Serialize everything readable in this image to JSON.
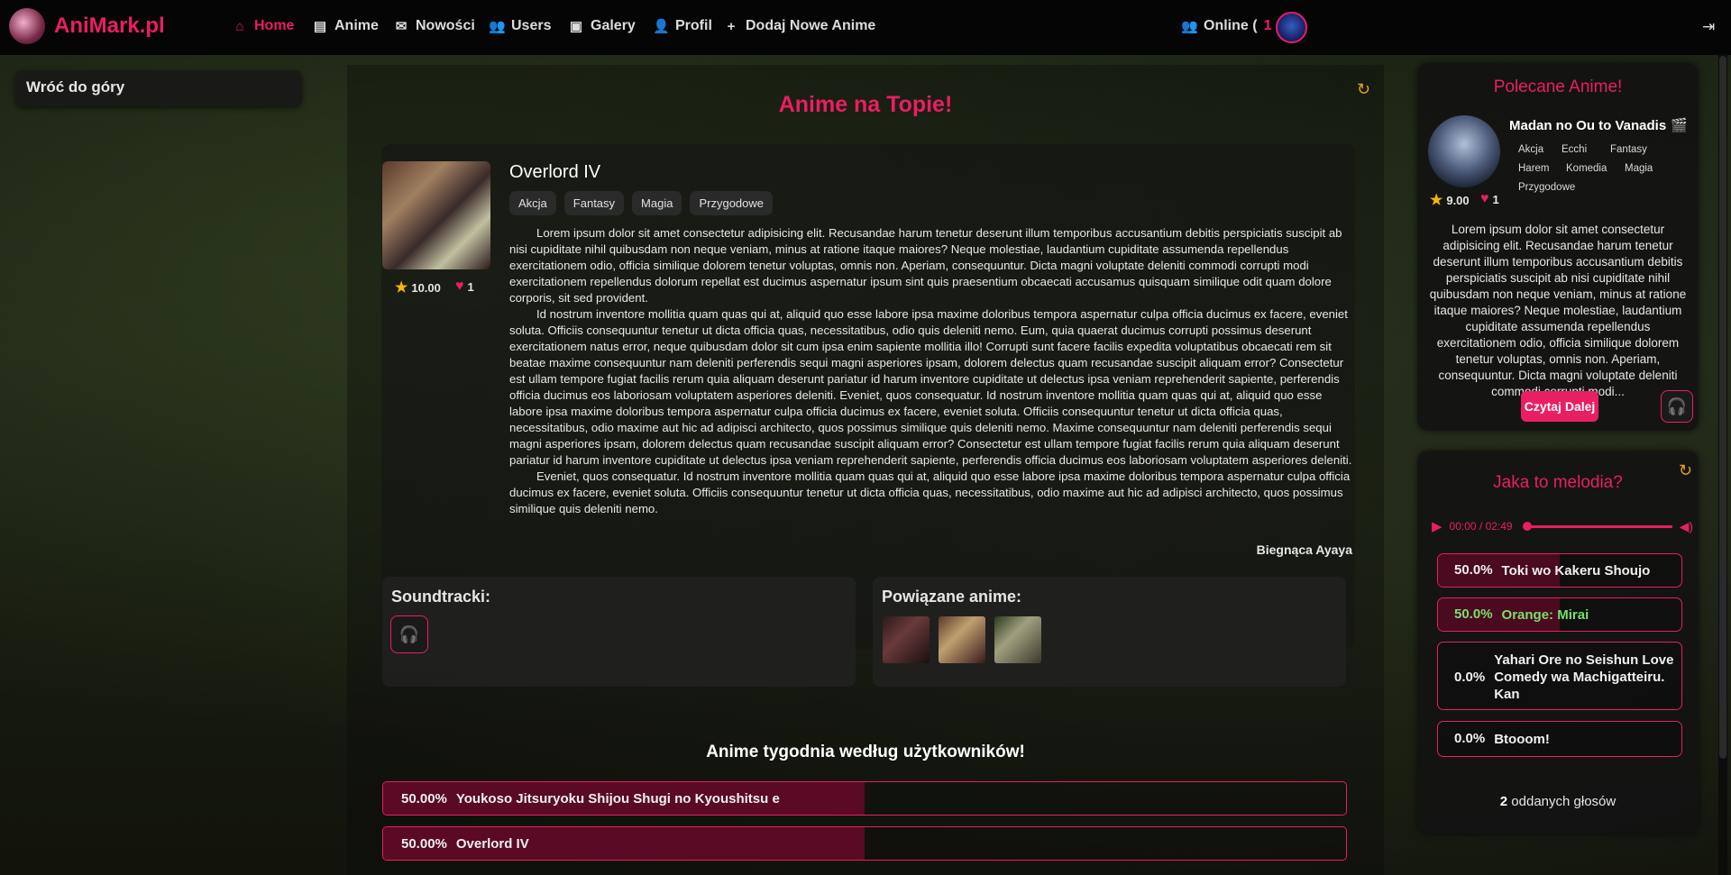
{
  "brand": {
    "name": "AniMark",
    "tld": ".pl"
  },
  "nav": {
    "items": [
      {
        "label": "Home",
        "icon": "home-icon",
        "active": true
      },
      {
        "label": "Anime",
        "icon": "clapperboard-icon"
      },
      {
        "label": "Nowości",
        "icon": "envelope-icon"
      },
      {
        "label": "Users",
        "icon": "users-icon"
      },
      {
        "label": "Galery",
        "icon": "images-icon"
      },
      {
        "label": "Profil",
        "icon": "user-icon"
      },
      {
        "label": "Dodaj Nowe Anime",
        "icon": "plus-icon"
      }
    ],
    "online_label": "Online (",
    "online_count": "1",
    "online_close": ")"
  },
  "sidebar": {
    "back_to_top": "Wróć do góry"
  },
  "top_anime": {
    "section_title": "Anime na Topie!",
    "title": "Overlord IV",
    "tags": [
      "Akcja",
      "Fantasy",
      "Magia",
      "Przygodowe"
    ],
    "rating": "10.00",
    "likes": "1",
    "description": [
      "Lorem ipsum dolor sit amet consectetur adipisicing elit. Recusandae harum tenetur deserunt illum temporibus accusantium debitis perspiciatis suscipit ab nisi cupiditate nihil quibusdam non neque veniam, minus at ratione itaque maiores? Neque molestiae, laudantium cupiditate assumenda repellendus exercitationem odio, officia similique dolorem tenetur voluptas, omnis non. Aperiam, consequuntur. Dicta magni voluptate deleniti commodi corrupti modi exercitationem repellendus dolorum repellat est ducimus aspernatur ipsum sint quis praesentium obcaecati accusamus quisquam similique odit quam dolore corporis, sit sed provident.",
      "Id nostrum inventore mollitia quam quas qui at, aliquid quo esse labore ipsa maxime doloribus tempora aspernatur culpa officia ducimus ex facere, eveniet soluta. Officiis consequuntur tenetur ut dicta officia quas, necessitatibus, odio quis deleniti nemo. Eum, quia quaerat ducimus corrupti possimus deserunt exercitationem natus error, neque quibusdam dolor sit cum ipsa enim sapiente mollitia illo! Corrupti sunt facere facilis expedita voluptatibus obcaecati rem sit beatae maxime consequuntur nam deleniti perferendis sequi magni asperiores ipsam, dolorem delectus quam recusandae suscipit aliquam error? Consectetur est ullam tempore fugiat facilis rerum quia aliquam deserunt pariatur id harum inventore cupiditate ut delectus ipsa veniam reprehenderit sapiente, perferendis officia ducimus eos laboriosam voluptatem asperiores deleniti. Eveniet, quos consequatur. Id nostrum inventore mollitia quam quas qui at, aliquid quo esse labore ipsa maxime doloribus tempora aspernatur culpa officia ducimus ex facere, eveniet soluta. Officiis consequuntur tenetur ut dicta officia quas, necessitatibus, odio maxime aut hic ad adipisci architecto, quos possimus similique quis deleniti nemo. Maxime consequuntur nam deleniti perferendis sequi magni asperiores ipsam, dolorem delectus quam recusandae suscipit aliquam error? Consectetur est ullam tempore fugiat facilis rerum quia aliquam deserunt pariatur id harum inventore cupiditate ut delectus ipsa veniam reprehenderit sapiente, perferendis officia ducimus eos laboriosam voluptatem asperiores deleniti.",
      "Eveniet, quos consequatur. Id nostrum inventore mollitia quam quas qui at, aliquid quo esse labore ipsa maxime doloribus tempora aspernatur culpa officia ducimus ex facere, eveniet soluta. Officiis consequuntur tenetur ut dicta officia quas, necessitatibus, odio maxime aut hic ad adipisci architecto, quos possimus similique quis deleniti nemo."
    ],
    "author": "Biegnąca Ayaya",
    "soundtracks_title": "Soundtracki:",
    "related_title": "Powiązane anime:"
  },
  "weekly": {
    "title": "Anime tygodnia według użytkowników!",
    "rows": [
      {
        "percent": "50.00%",
        "name": "Youkoso Jitsuryoku Shijou Shugi no Kyoushitsu e",
        "fill": 0.5
      },
      {
        "percent": "50.00%",
        "name": "Overlord IV",
        "fill": 0.5
      }
    ]
  },
  "recommended": {
    "title": "Polecane Anime!",
    "name": "Madan no Ou to Vanadis",
    "tags": [
      "Akcja",
      "Ecchi",
      "Fantasy",
      "Harem",
      "Komedia",
      "Magia",
      "Przygodowe"
    ],
    "rating": "9.00",
    "likes": "1",
    "description": "Lorem ipsum dolor sit amet consectetur adipisicing elit. Recusandae harum tenetur deserunt illum temporibus accusantium debitis perspiciatis suscipit ab nisi cupiditate nihil quibusdam non neque veniam, minus at ratione itaque maiores? Neque molestiae, laudantium cupiditate assumenda repellendus exercitationem odio, officia similique dolorem tenetur voluptas, omnis non. Aperiam, consequuntur. Dicta magni voluptate deleniti commodi corrupti modi...",
    "read_more": "Czytaj Dalej"
  },
  "melody": {
    "title": "Jaka to melodia?",
    "time": "00:00 / 02:49",
    "answers": [
      {
        "percent": "50.0%",
        "name": "Toki wo Kakeru Shoujo",
        "fill": 0.5,
        "correct": false
      },
      {
        "percent": "50.0%",
        "name": "Orange: Mirai",
        "fill": 0.5,
        "correct": true
      },
      {
        "percent": "0.0%",
        "name": "Yahari Ore no Seishun Love Comedy wa Machigatteiru. Kan",
        "fill": 0,
        "correct": false
      },
      {
        "percent": "0.0%",
        "name": "Btooom!",
        "fill": 0,
        "correct": false
      }
    ],
    "votes_count": "2",
    "votes_label": "oddanych głosów"
  },
  "colors": {
    "accent": "#e91e63",
    "correct": "#7adf6a",
    "star": "#f5b800"
  }
}
